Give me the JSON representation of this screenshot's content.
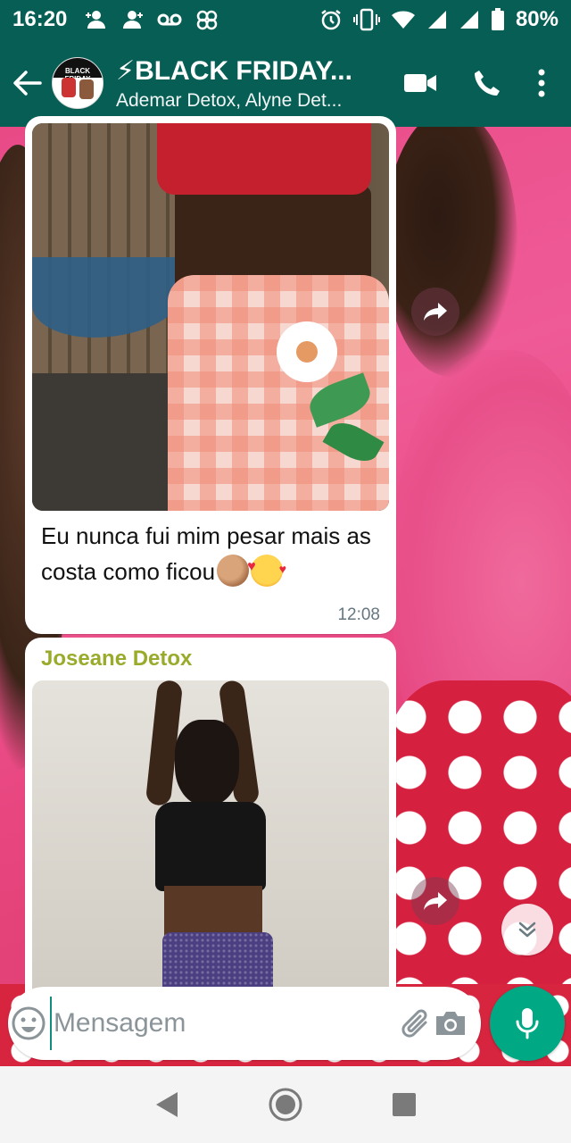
{
  "status_bar": {
    "time": "16:20",
    "battery": "80%",
    "icons_left": [
      "person-add-icon",
      "person-add-icon",
      "voicemail-icon",
      "pinwheel-icon"
    ],
    "icons_right": [
      "alarm-icon",
      "vibrate-icon",
      "wifi-icon",
      "signal-icon",
      "signal-icon",
      "battery-icon"
    ]
  },
  "header": {
    "title": "⚡BLACK FRIDAY...",
    "subtitle": "Ademar Detox, Alyne Det...",
    "avatar_text": "BLACK FRIDAY",
    "actions": [
      "video-call-icon",
      "voice-call-icon",
      "more-options-icon"
    ]
  },
  "messages": [
    {
      "type": "image",
      "caption": "Eu nunca fui mim pesar mais as costa como ficou",
      "caption_emojis": [
        "clapping-hands-emoji",
        "smiling-face-with-hearts-emoji"
      ],
      "time": "12:08"
    },
    {
      "type": "image",
      "sender": "Joseane Detox",
      "sender_color": "#9aab2c"
    }
  ],
  "composer": {
    "placeholder": "Mensagem",
    "value": ""
  },
  "colors": {
    "header_bg": "#075e54",
    "mic_bg": "#00a884",
    "cursor": "#128c7e"
  }
}
